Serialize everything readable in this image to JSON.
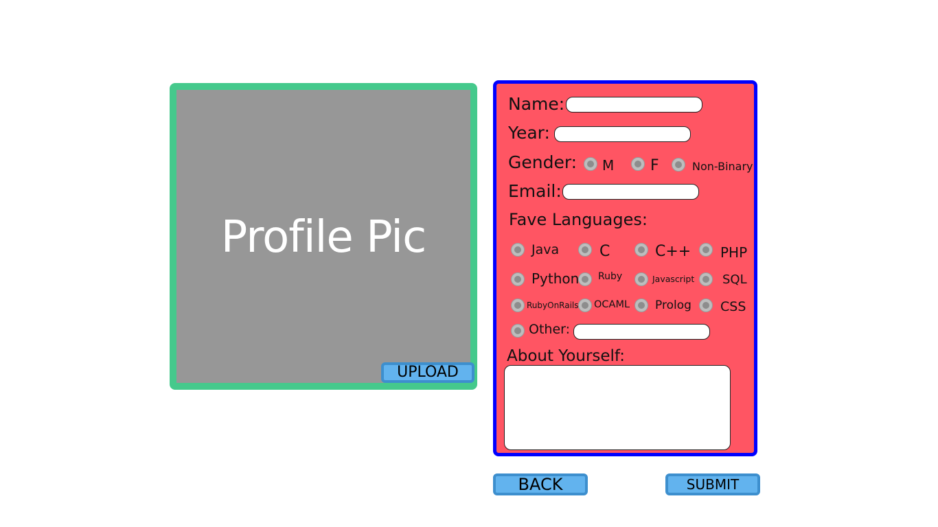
{
  "profile": {
    "pic_label": "Profile Pic",
    "upload_label": "UPLOAD"
  },
  "form": {
    "name_label": "Name:",
    "name_value": "",
    "year_label": "Year:",
    "year_value": "",
    "gender_label": "Gender:",
    "gender_options": [
      "M",
      "F",
      "Non-Binary"
    ],
    "email_label": "Email:",
    "email_value": "",
    "languages_label": "Fave Languages:",
    "languages": [
      "Java",
      "C",
      "C++",
      "PHP",
      "Python",
      "Ruby",
      "Javascript",
      "SQL",
      "RubyOnRails",
      "OCAML",
      "Prolog",
      "CSS"
    ],
    "other_label": "Other:",
    "other_value": "",
    "about_label": "About Yourself:",
    "about_value": ""
  },
  "actions": {
    "back_label": "BACK",
    "submit_label": "SUBMIT"
  },
  "colors": {
    "pic_border": "#45c98c",
    "pic_fill": "#979797",
    "form_border": "#0000ff",
    "form_fill": "#ff5563",
    "button_fill": "#62b3ee",
    "button_border": "#3d8fce"
  }
}
